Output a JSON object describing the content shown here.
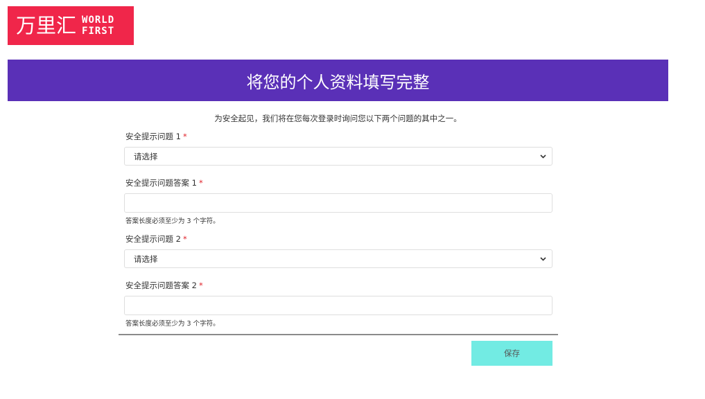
{
  "logo": {
    "cn_text": "万里汇",
    "en_line1": "WORLD",
    "en_line2": "FIRST"
  },
  "banner": {
    "title": "将您的个人资料填写完整"
  },
  "intro": "为安全起见，我们将在您每次登录时询问您以下两个问题的其中之一。",
  "form": {
    "question1": {
      "label": "安全提示问题 1",
      "required_mark": "*",
      "selected": "请选择"
    },
    "answer1": {
      "label": "安全提示问题答案 1",
      "required_mark": "*",
      "value": "",
      "hint": "答案长度必须至少为 3 个字符。"
    },
    "question2": {
      "label": "安全提示问题 2",
      "required_mark": "*",
      "selected": "请选择"
    },
    "answer2": {
      "label": "安全提示问题答案 2",
      "required_mark": "*",
      "value": "",
      "hint": "答案长度必须至少为 3 个字符。"
    }
  },
  "actions": {
    "save_label": "保存"
  },
  "colors": {
    "logo_bg": "#f0264a",
    "banner_bg": "#5a30b7",
    "save_bg": "#72ebe3",
    "required": "#e0242c"
  },
  "icons": {
    "select_arrow": "chevron-down-icon"
  }
}
